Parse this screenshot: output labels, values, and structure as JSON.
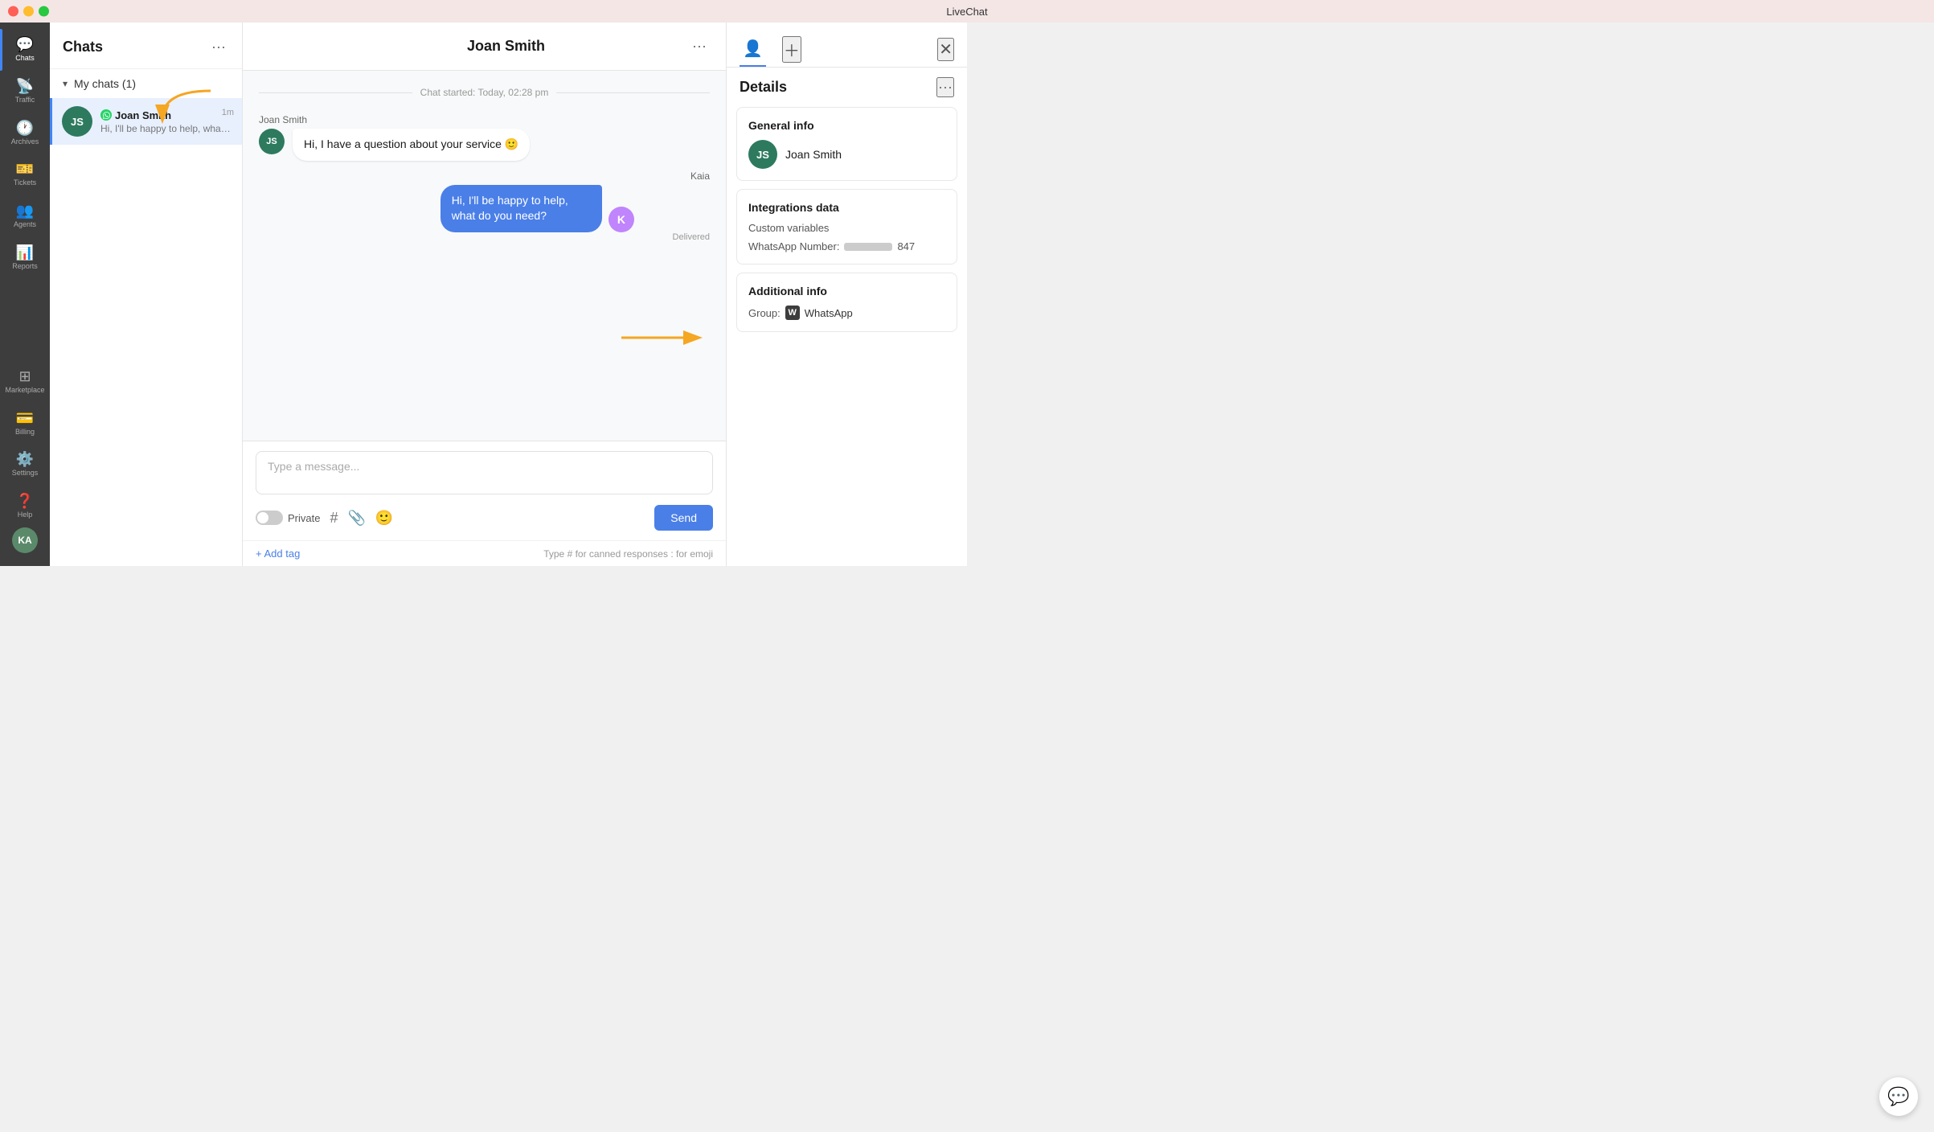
{
  "app": {
    "title": "LiveChat"
  },
  "sidebar": {
    "items": [
      {
        "id": "chats",
        "label": "Chats",
        "icon": "💬",
        "active": true
      },
      {
        "id": "traffic",
        "label": "Traffic",
        "icon": "📡",
        "active": false
      },
      {
        "id": "archives",
        "label": "Archives",
        "icon": "🕐",
        "active": false
      },
      {
        "id": "tickets",
        "label": "Tickets",
        "icon": "🎫",
        "active": false
      },
      {
        "id": "agents",
        "label": "Agents",
        "icon": "👥",
        "active": false
      },
      {
        "id": "reports",
        "label": "Reports",
        "icon": "📊",
        "active": false
      },
      {
        "id": "marketplace",
        "label": "Marketplace",
        "icon": "⊞",
        "active": false
      },
      {
        "id": "billing",
        "label": "Billing",
        "icon": "💳",
        "active": false
      },
      {
        "id": "settings",
        "label": "Settings",
        "icon": "⚙️",
        "active": false
      },
      {
        "id": "help",
        "label": "Help",
        "icon": "❓",
        "active": false
      }
    ],
    "user_initials": "KA"
  },
  "chat_list": {
    "title": "Chats",
    "my_chats_label": "My chats (1)",
    "items": [
      {
        "id": "joan-smith",
        "name": "Joan Smith",
        "initials": "JS",
        "preview": "Hi, I'll be happy to help, what do ...",
        "time": "1m",
        "active": true,
        "has_whatsapp": true
      }
    ]
  },
  "chat_window": {
    "title": "Joan Smith",
    "start_text": "Chat started: Today, 02:28 pm",
    "messages": [
      {
        "id": "msg1",
        "sender": "Joan Smith",
        "sender_initials": "JS",
        "direction": "incoming",
        "text": "Hi, I have a question about your service 🙂",
        "avatar_color": "#2d7a5f"
      },
      {
        "id": "msg2",
        "sender": "Kaia",
        "direction": "outgoing",
        "text": "Hi, I'll be happy to help, what do you need?",
        "status": "Delivered",
        "avatar_color": "#c084fc"
      }
    ],
    "input": {
      "placeholder": "Type a message...",
      "private_label": "Private",
      "send_label": "Send"
    },
    "footer": {
      "add_tag": "+ Add tag",
      "hint": "Type # for canned responses : for emoji"
    }
  },
  "right_panel": {
    "title": "Details",
    "sections": {
      "general_info": {
        "title": "General info",
        "name": "Joan Smith",
        "initials": "JS"
      },
      "integrations_data": {
        "title": "Integrations data",
        "custom_variables_label": "Custom variables",
        "whatsapp_number_label": "WhatsApp Number:",
        "whatsapp_number_suffix": "847"
      },
      "additional_info": {
        "title": "Additional info",
        "group_label": "Group:",
        "group_name": "WhatsApp",
        "group_icon_letter": "W"
      }
    }
  }
}
